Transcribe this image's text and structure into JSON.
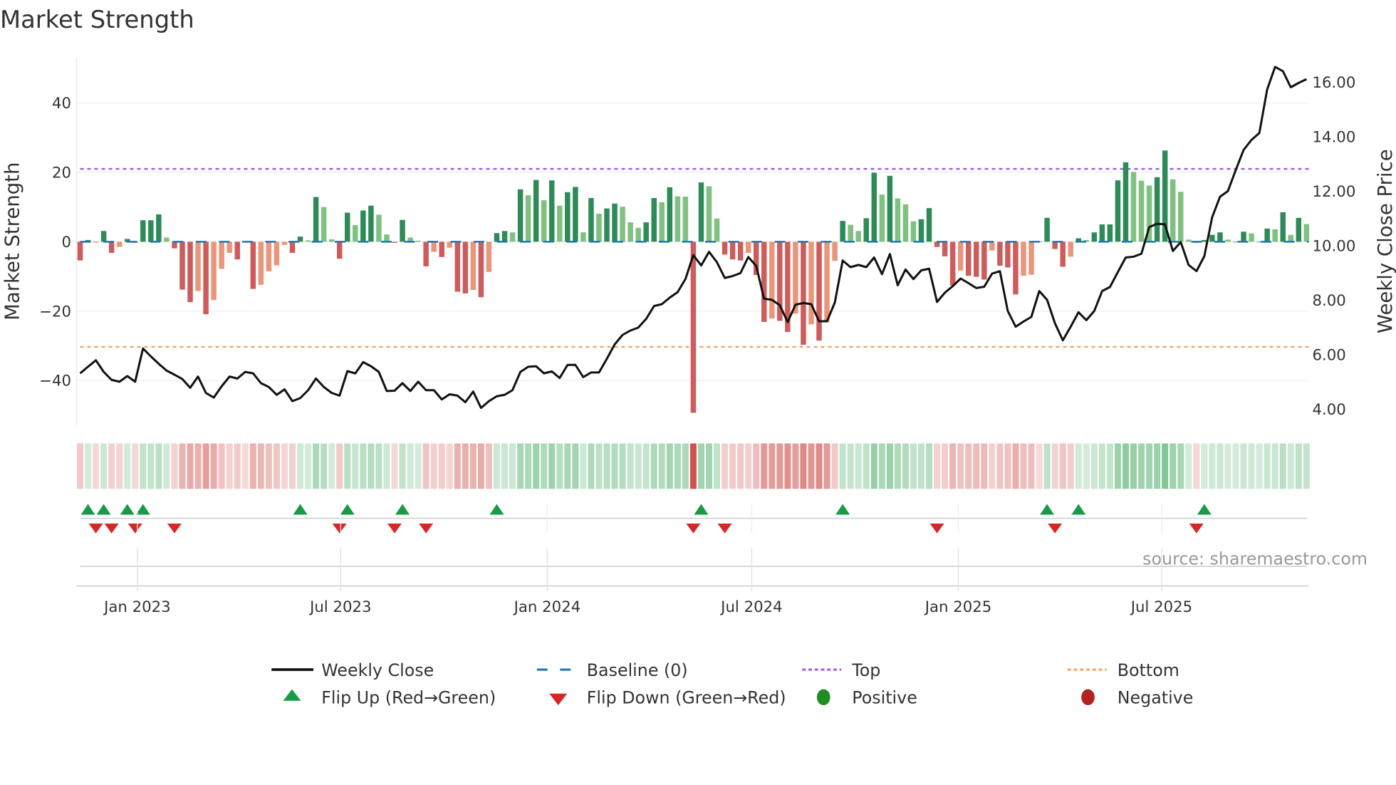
{
  "title": "Market Strength",
  "source_note": "source: sharemaestro.com",
  "colors": {
    "pos_strong": "#2e8b57",
    "pos_weak": "#80c080",
    "neg_strong": "#cd5c5c",
    "neg_weak": "#e9967a",
    "line": "#111111",
    "baseline": "#1f77b4",
    "top": "#a25ee6",
    "bottom": "#f0a868",
    "flip_up": "#1a9a48",
    "flip_down": "#d62728",
    "positive": "#228b22",
    "negative": "#b22222"
  },
  "chart_data": {
    "type": "bar+line",
    "title": "Market Strength",
    "ylabel": "Market Strength",
    "y2label": "Weekly Close Price",
    "start_date": "2022-11-11",
    "interval_days": 7,
    "ylim": [
      -53,
      53
    ],
    "y2lim": [
      3.4,
      16.9
    ],
    "yticks": [
      -40,
      -20,
      0,
      20,
      40
    ],
    "yticklabels": [
      "−40",
      "−20",
      "0",
      "20",
      "40"
    ],
    "y2ticks": [
      4,
      6,
      8,
      10,
      12,
      14,
      16
    ],
    "y2ticklabels": [
      "4.00",
      "6.00",
      "8.00",
      "10.00",
      "12.00",
      "14.00",
      "16.00"
    ],
    "xticks": [
      {
        "date": "2023-01-01",
        "label": "Jan 2023"
      },
      {
        "date": "2023-07-01",
        "label": "Jul 2023"
      },
      {
        "date": "2024-01-01",
        "label": "Jan 2024"
      },
      {
        "date": "2024-07-01",
        "label": "Jul 2024"
      },
      {
        "date": "2025-01-01",
        "label": "Jan 2025"
      },
      {
        "date": "2025-07-01",
        "label": "Jul 2025"
      }
    ],
    "top_level": 21,
    "bottom_level": -30.3,
    "baseline": 0,
    "strength": [
      -5.4,
      0.5,
      -0.2,
      3.1,
      -3.2,
      -1.5,
      0.8,
      -0.3,
      6.2,
      6.2,
      7.9,
      1.2,
      -1.9,
      -13.8,
      -17.4,
      -14.2,
      -20.9,
      -16.8,
      -7.8,
      -3.2,
      -5.1,
      0,
      -13.6,
      -12.4,
      -8.5,
      -6.8,
      -0.9,
      -3.2,
      1.5,
      0.4,
      12.9,
      10,
      0.7,
      -4.9,
      8.4,
      4.8,
      9,
      10.4,
      7.8,
      2.1,
      -0.3,
      6.3,
      1.2,
      0.3,
      -7.1,
      -2.9,
      -4.4,
      -1.7,
      -14.4,
      -14.9,
      -13.9,
      -16,
      -8.7,
      2.5,
      3.1,
      2.7,
      15.1,
      13.4,
      17.8,
      12,
      17.7,
      10.4,
      14.3,
      15.8,
      2.7,
      12.6,
      8.1,
      9.6,
      11,
      10.1,
      5.6,
      4,
      5.6,
      12.6,
      11.4,
      15.7,
      13.1,
      13,
      -49.3,
      17.1,
      16,
      6.7,
      -3.7,
      -5.1,
      -5.4,
      -3.2,
      -9.6,
      -23.1,
      -22.1,
      -22.8,
      -26,
      -20.7,
      -29.7,
      -23.8,
      -28.5,
      -23.2,
      -5.5,
      6,
      4.9,
      3.1,
      6.8,
      19.9,
      13.6,
      19,
      12.5,
      10.8,
      5.9,
      6.5,
      9.7,
      -1.5,
      -4.2,
      -12.6,
      -8.3,
      -9.8,
      -10.1,
      -10.9,
      -2.5,
      -6.9,
      -7.4,
      -15.2,
      -9.8,
      -9.5,
      0,
      6.9,
      -2.1,
      -7.2,
      -4.3,
      1,
      0.5,
      2.7,
      5,
      5,
      17.7,
      22.9,
      20.1,
      17.6,
      16.2,
      18.6,
      26.3,
      18,
      14.4,
      0.6,
      -0.3,
      0.5,
      2,
      2.7,
      0.6,
      0,
      2.9,
      2.4,
      0,
      3.8,
      3.6,
      8.5,
      2,
      6.9,
      5.1
    ],
    "weekly_close": [
      5.32,
      5.56,
      5.8,
      5.37,
      5.08,
      5.01,
      5.22,
      5.01,
      6.23,
      5.94,
      5.67,
      5.42,
      5.27,
      5.11,
      4.79,
      5.2,
      4.6,
      4.43,
      4.84,
      5.2,
      5.13,
      5.37,
      5.32,
      4.96,
      4.82,
      4.53,
      4.73,
      4.3,
      4.41,
      4.7,
      5.13,
      4.82,
      4.6,
      4.5,
      5.4,
      5.32,
      5.73,
      5.58,
      5.37,
      4.67,
      4.68,
      4.96,
      4.67,
      5.01,
      4.7,
      4.7,
      4.36,
      4.55,
      4.5,
      4.26,
      4.65,
      4.05,
      4.3,
      4.48,
      4.53,
      4.7,
      5.37,
      5.56,
      5.58,
      5.32,
      5.39,
      5.15,
      5.63,
      5.63,
      5.18,
      5.35,
      5.35,
      5.85,
      6.38,
      6.73,
      6.89,
      7.0,
      7.32,
      7.79,
      7.86,
      8.1,
      8.3,
      8.78,
      9.66,
      9.28,
      9.78,
      9.4,
      8.82,
      8.89,
      9.0,
      9.59,
      9.26,
      8.06,
      8.02,
      7.82,
      7.2,
      7.84,
      7.9,
      7.86,
      7.23,
      7.23,
      7.92,
      9.46,
      9.22,
      9.3,
      9.22,
      9.57,
      8.96,
      9.7,
      8.55,
      9.13,
      8.78,
      9.1,
      9.16,
      7.94,
      8.28,
      8.52,
      8.8,
      8.63,
      8.45,
      8.5,
      8.98,
      9.07,
      7.61,
      7.03,
      7.22,
      7.39,
      8.34,
      8.02,
      7.16,
      6.53,
      7.03,
      7.56,
      7.27,
      7.61,
      8.34,
      8.49,
      9.04,
      9.57,
      9.6,
      9.71,
      10.69,
      10.81,
      10.79,
      9.81,
      10.14,
      9.3,
      9.07,
      9.62,
      11.05,
      11.8,
      12.01,
      12.78,
      13.52,
      13.89,
      14.14,
      15.74,
      16.57,
      16.41,
      15.82,
      15.98,
      16.12
    ],
    "flip_up_weeks": [
      1,
      3,
      6,
      8,
      28,
      34,
      41,
      53,
      79,
      97,
      123,
      127,
      143
    ],
    "flip_down_weeks": [
      2,
      4,
      7,
      12,
      33,
      40,
      44,
      78,
      82,
      109,
      124,
      142
    ],
    "legend": {
      "weekly_close": "Weekly Close",
      "baseline": "Baseline (0)",
      "top": "Top",
      "bottom": "Bottom",
      "flip_up": "Flip Up (Red→Green)",
      "flip_down": "Flip Down (Green→Red)",
      "positive": "Positive",
      "negative": "Negative"
    },
    "legend_placement": "bottom",
    "grid": true
  }
}
